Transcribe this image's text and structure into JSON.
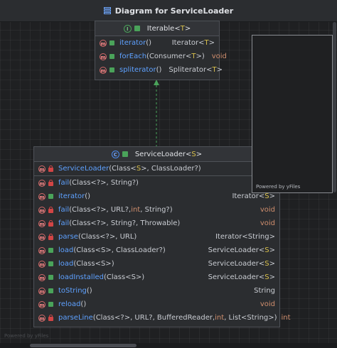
{
  "window": {
    "title": "Diagram for ServiceLoader"
  },
  "iterable": {
    "title": "Iterable",
    "type_param": "T",
    "methods": [
      {
        "name": "iterator",
        "params": "()",
        "ret": "Iterator",
        "ret_tp": "T"
      },
      {
        "name": "forEach",
        "params_prefix": "(Consumer<",
        "params_tp": "T",
        "params_suffix": ">)",
        "ret": "void"
      },
      {
        "name": "spliterator",
        "params": "()",
        "ret": "Spliterator",
        "ret_tp": "T"
      }
    ]
  },
  "service_loader": {
    "title": "ServiceLoader",
    "type_param": "S",
    "constructor": {
      "name": "ServiceLoader",
      "sig_a": "(Class<",
      "sig_tp": "S",
      "sig_b": ">, ClassLoader?)"
    },
    "methods": [
      {
        "name": "fail",
        "sig": "(Class<?>, String?)",
        "ret": "",
        "vis": "private"
      },
      {
        "name": "iterator",
        "sig": "()",
        "ret": "Iterator",
        "ret_tp": "S",
        "vis": "public"
      },
      {
        "name": "fail",
        "sig_a": "(Class<?>, URL?, ",
        "sig_kw": "int",
        "sig_b": ", String?)",
        "ret": "void",
        "vis": "private"
      },
      {
        "name": "fail",
        "sig": "(Class<?>, String?, Throwable)",
        "ret": "void",
        "vis": "private"
      },
      {
        "name": "parse",
        "sig": "(Class<?>, URL)",
        "ret": "Iterator<String>",
        "vis": "private"
      },
      {
        "name": "load",
        "sig": "(Class<S>, ClassLoader?)",
        "ret": "ServiceLoader",
        "ret_tp": "S",
        "vis": "public"
      },
      {
        "name": "load",
        "sig": "(Class<S>)",
        "ret": "ServiceLoader",
        "ret_tp": "S",
        "vis": "public"
      },
      {
        "name": "loadInstalled",
        "sig": "(Class<S>)",
        "ret": "ServiceLoader",
        "ret_tp": "S",
        "vis": "public"
      },
      {
        "name": "toString",
        "sig": "()",
        "ret": "String",
        "vis": "public"
      },
      {
        "name": "reload",
        "sig": "()",
        "ret": "void",
        "vis": "public"
      },
      {
        "name": "parseLine",
        "sig_a": "(Class<?>, URL?, BufferedReader, ",
        "sig_kw": "int",
        "sig_b": ", List<String>)",
        "ret": "int",
        "vis": "private"
      }
    ]
  },
  "overview": {
    "powered_by": "Powered by yFiles"
  },
  "watermark": "Powered by yFiles",
  "colors": {
    "name": "#5ea1ff",
    "type_param": "#d9c04d",
    "keyword": "#cf8e6d",
    "edge": "#4aa35a"
  }
}
